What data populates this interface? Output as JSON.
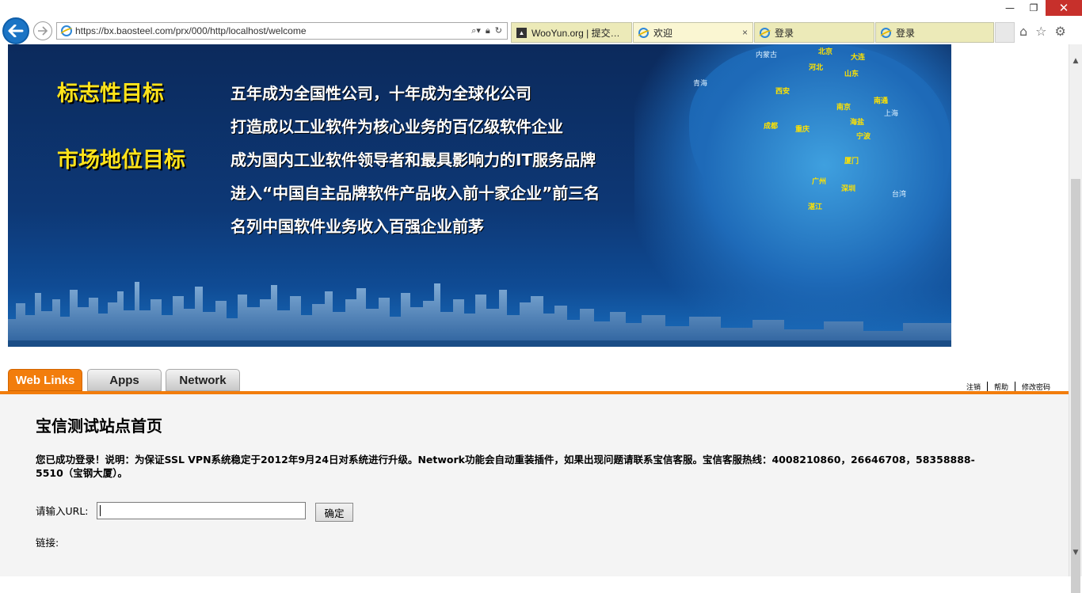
{
  "browser": {
    "url": "https://bx.baosteel.com/prx/000/http/localhost/welcome",
    "tabs": [
      {
        "label": "WooYun.org | 提交…",
        "active": false
      },
      {
        "label": "欢迎",
        "active": true,
        "close": "×"
      },
      {
        "label": "登录",
        "active": false
      },
      {
        "label": "登录",
        "active": false
      }
    ]
  },
  "banner": {
    "targets": [
      {
        "title": "标志性目标",
        "lines": [
          "五年成为全国性公司，十年成为全球化公司",
          "打造成以工业软件为核心业务的百亿级软件企业"
        ]
      },
      {
        "title": "市场地位目标",
        "lines": [
          "成为国内工业软件领导者和最具影响力的IT服务品牌",
          "进入“中国自主品牌软件产品收入前十家企业”前三名",
          "名列中国软件业务收入百强企业前茅"
        ]
      }
    ],
    "cities": [
      "内蒙古",
      "北京",
      "大连",
      "河北",
      "山东",
      "青海",
      "西安",
      "南京",
      "南通",
      "上海",
      "海盐",
      "宁波",
      "成都",
      "重庆",
      "厦门",
      "广州",
      "深圳",
      "湛江",
      "台湾"
    ]
  },
  "apptabs": [
    "Web Links",
    "Apps",
    "Network"
  ],
  "toplinks": [
    "注销",
    "帮助",
    "修改密码"
  ],
  "content": {
    "title": "宝信测试站点首页",
    "notice": "您已成功登录！说明：为保证SSL VPN系统稳定于2012年9月24日对系统进行升级。Network功能会自动重装插件，如果出现问题请联系宝信客服。宝信客服热线：4008210860，26646708，58358888-5510（宝钢大厦）。",
    "url_label": "请输入URL:",
    "url_value": "",
    "ok_label": "确定",
    "link_label": "链接:"
  },
  "colors": {
    "accent": "#f27d0c",
    "banner_yellow": "#ffe31a"
  }
}
